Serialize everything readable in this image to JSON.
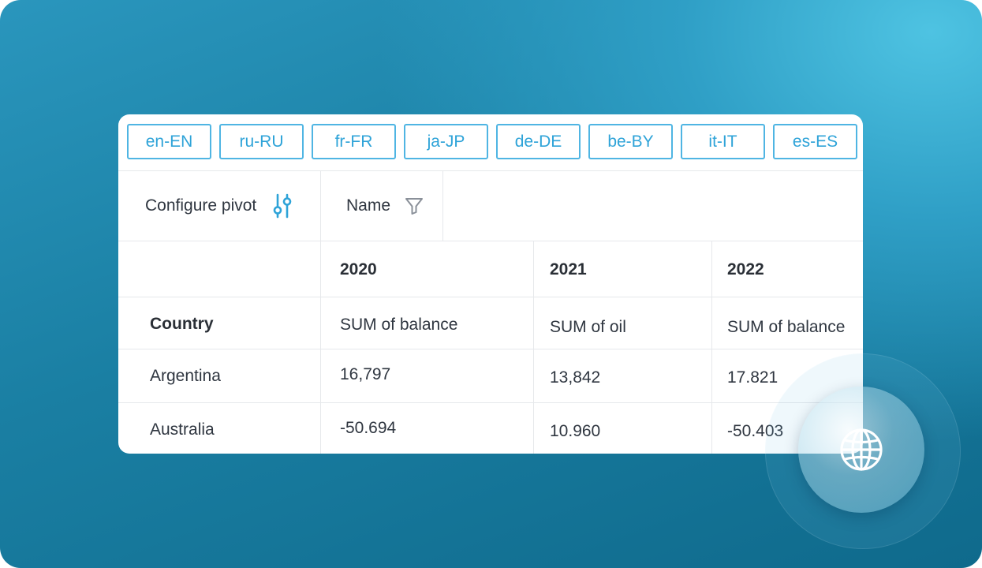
{
  "locales": [
    "en-EN",
    "ru-RU",
    "fr-FR",
    "ja-JP",
    "de-DE",
    "be-BY",
    "it-IT",
    "es-ES"
  ],
  "toolbar": {
    "configure_label": "Configure pivot",
    "name_label": "Name"
  },
  "table": {
    "row_header": "Country",
    "columns": [
      {
        "year": "2020",
        "measure": "SUM of balance"
      },
      {
        "year": "2021",
        "measure": "SUM of oil"
      },
      {
        "year": "2022",
        "measure": "SUM of balance"
      }
    ],
    "rows": [
      {
        "country": "Argentina",
        "values": [
          "16,797",
          "13,842",
          "17.821"
        ]
      },
      {
        "country": "Australia",
        "values": [
          "-50.694",
          "10.960",
          "-50.403"
        ]
      }
    ]
  },
  "icons": {
    "configure": "sliders-icon",
    "filter": "filter-icon",
    "globe": "globe-icon"
  },
  "colors": {
    "accent": "#2ea3d8",
    "locale_border": "#4fb5e3",
    "background": "#1a7fa3"
  }
}
